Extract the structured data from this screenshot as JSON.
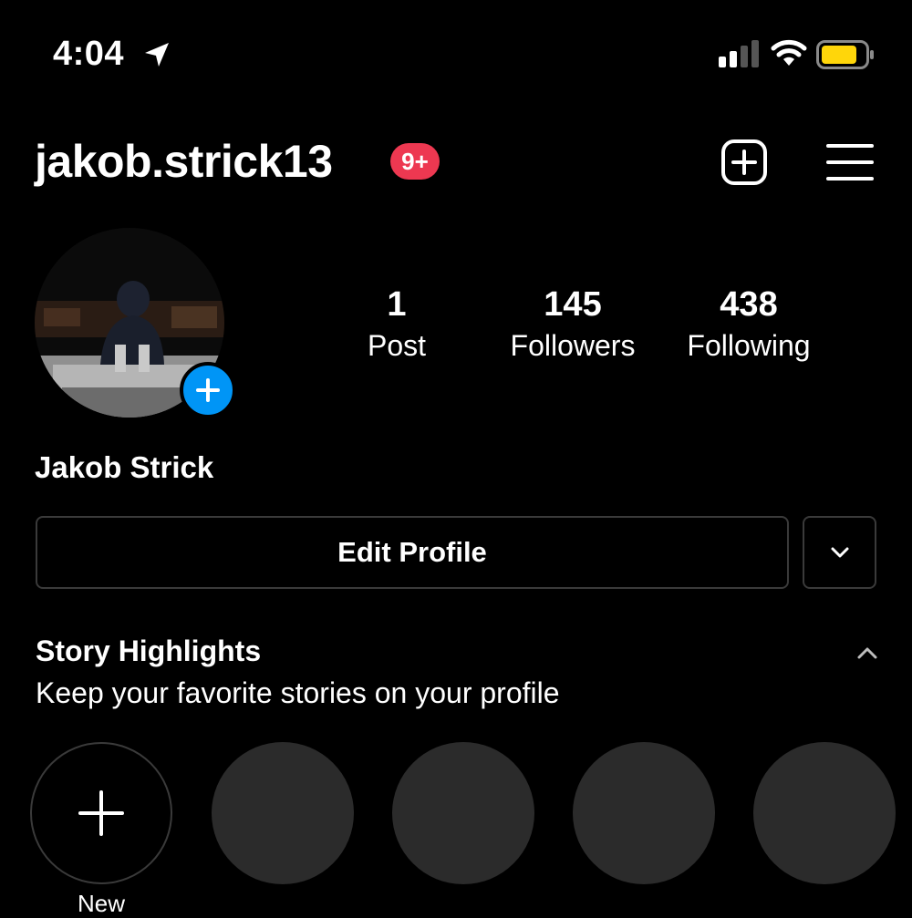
{
  "status_bar": {
    "time": "4:04",
    "battery_color": "#ffd60a"
  },
  "header": {
    "username": "jakob.strick13",
    "notification_badge": "9+",
    "badge_color": "#ed3851"
  },
  "profile": {
    "full_name": "Jakob Strick",
    "stats": [
      {
        "value": "1",
        "label": "Post"
      },
      {
        "value": "145",
        "label": "Followers"
      },
      {
        "value": "438",
        "label": "Following"
      }
    ]
  },
  "actions": {
    "edit_profile_label": "Edit Profile"
  },
  "highlights": {
    "title": "Story Highlights",
    "subtitle": "Keep your favorite stories on your profile",
    "new_label": "New"
  },
  "icons": {
    "location": "location-arrow-icon",
    "signal": "cellular-signal-icon",
    "wifi": "wifi-icon",
    "battery": "battery-icon",
    "add": "add-post-icon",
    "menu": "hamburger-menu-icon",
    "avatar_add": "plus-icon",
    "dropdown": "chevron-down-icon",
    "collapse": "chevron-up-icon",
    "new_highlight": "plus-icon"
  },
  "colors": {
    "accent_blue": "#0095f6",
    "background": "#000000",
    "border": "#3a3a3a"
  }
}
